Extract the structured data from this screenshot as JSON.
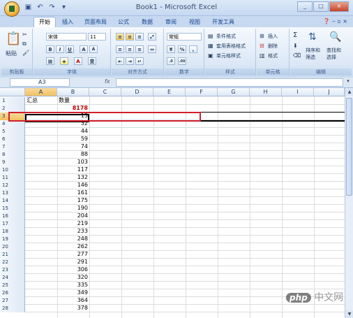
{
  "window": {
    "title": "Book1 - Microsoft Excel",
    "qat": [
      "save-icon",
      "undo-icon",
      "redo-icon"
    ],
    "controls": [
      "_",
      "□",
      "×"
    ]
  },
  "tabs": [
    {
      "label": "开始",
      "active": true
    },
    {
      "label": "插入"
    },
    {
      "label": "页面布局"
    },
    {
      "label": "公式"
    },
    {
      "label": "数据"
    },
    {
      "label": "审阅"
    },
    {
      "label": "视图"
    },
    {
      "label": "开发工具"
    }
  ],
  "ribbon": {
    "clipboard": {
      "label": "剪贴板",
      "paste": "粘贴"
    },
    "font": {
      "label": "字体",
      "name": "宋体",
      "size": "11",
      "grow": "A",
      "shrink": "A",
      "bold": "B",
      "italic": "I",
      "underline": "U",
      "phonetic": "变"
    },
    "alignment": {
      "label": "对齐方式"
    },
    "number": {
      "label": "数字",
      "format": "常规",
      "percent": "%",
      "comma": ","
    },
    "styles": {
      "label": "样式",
      "cond": "条件格式",
      "table": "套用表格格式",
      "cell": "单元格样式"
    },
    "cells": {
      "label": "单元格",
      "insert": "插入",
      "delete": "删除",
      "format": "格式"
    },
    "editing": {
      "label": "编辑",
      "sum": "Σ",
      "sort": "排序和",
      "sort2": "筛选",
      "find": "查找和",
      "find2": "选择"
    }
  },
  "formula_bar": {
    "name_box": "A3",
    "fx": "fx",
    "value": ""
  },
  "columns": [
    "A",
    "B",
    "C",
    "D",
    "E",
    "F",
    "G",
    "H",
    "I",
    "J"
  ],
  "rows": [
    {
      "n": "1",
      "a": "汇总",
      "b": "数量"
    },
    {
      "n": "2",
      "a": "",
      "b": "8178"
    },
    {
      "n": "3",
      "a": "",
      "b": "15"
    },
    {
      "n": "4",
      "a": "",
      "b": "32"
    },
    {
      "n": "5",
      "a": "",
      "b": "44"
    },
    {
      "n": "6",
      "a": "",
      "b": "59"
    },
    {
      "n": "7",
      "a": "",
      "b": "74"
    },
    {
      "n": "8",
      "a": "",
      "b": "88"
    },
    {
      "n": "9",
      "a": "",
      "b": "103"
    },
    {
      "n": "10",
      "a": "",
      "b": "117"
    },
    {
      "n": "11",
      "a": "",
      "b": "132"
    },
    {
      "n": "12",
      "a": "",
      "b": "146"
    },
    {
      "n": "13",
      "a": "",
      "b": "161"
    },
    {
      "n": "14",
      "a": "",
      "b": "175"
    },
    {
      "n": "15",
      "a": "",
      "b": "190"
    },
    {
      "n": "16",
      "a": "",
      "b": "204"
    },
    {
      "n": "17",
      "a": "",
      "b": "219"
    },
    {
      "n": "18",
      "a": "",
      "b": "233"
    },
    {
      "n": "19",
      "a": "",
      "b": "248"
    },
    {
      "n": "20",
      "a": "",
      "b": "262"
    },
    {
      "n": "21",
      "a": "",
      "b": "277"
    },
    {
      "n": "22",
      "a": "",
      "b": "291"
    },
    {
      "n": "23",
      "a": "",
      "b": "306"
    },
    {
      "n": "24",
      "a": "",
      "b": "320"
    },
    {
      "n": "25",
      "a": "",
      "b": "335"
    },
    {
      "n": "26",
      "a": "",
      "b": "349"
    },
    {
      "n": "27",
      "a": "",
      "b": "364"
    },
    {
      "n": "28",
      "a": "",
      "b": "378"
    }
  ],
  "selected": {
    "row": "3",
    "col": "A"
  },
  "watermark": {
    "logo": "php",
    "text": "中文网"
  }
}
